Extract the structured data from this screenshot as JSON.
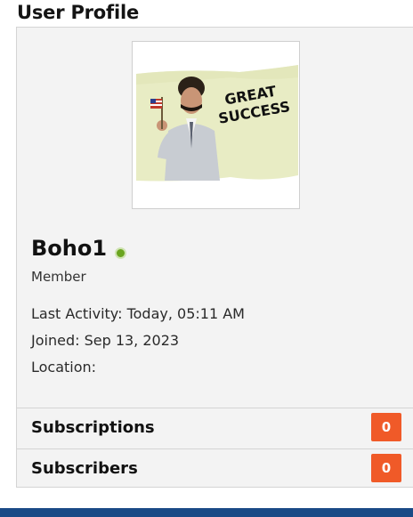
{
  "header": {
    "title": "User Profile"
  },
  "profile": {
    "avatar": {
      "banner_text_line1": "GREAT",
      "banner_text_line2": "SUCCESS"
    },
    "username": "Boho1",
    "online_status_color": "#6aa51f",
    "role": "Member",
    "last_activity": "Last Activity: Today, 05:11 AM",
    "joined": "Joined: Sep 13, 2023",
    "location": "Location:"
  },
  "stats": [
    {
      "label": "Subscriptions",
      "count": "0"
    },
    {
      "label": "Subscribers",
      "count": "0"
    }
  ],
  "colors": {
    "badge": "#f05a28",
    "footer": "#1a4a86"
  }
}
